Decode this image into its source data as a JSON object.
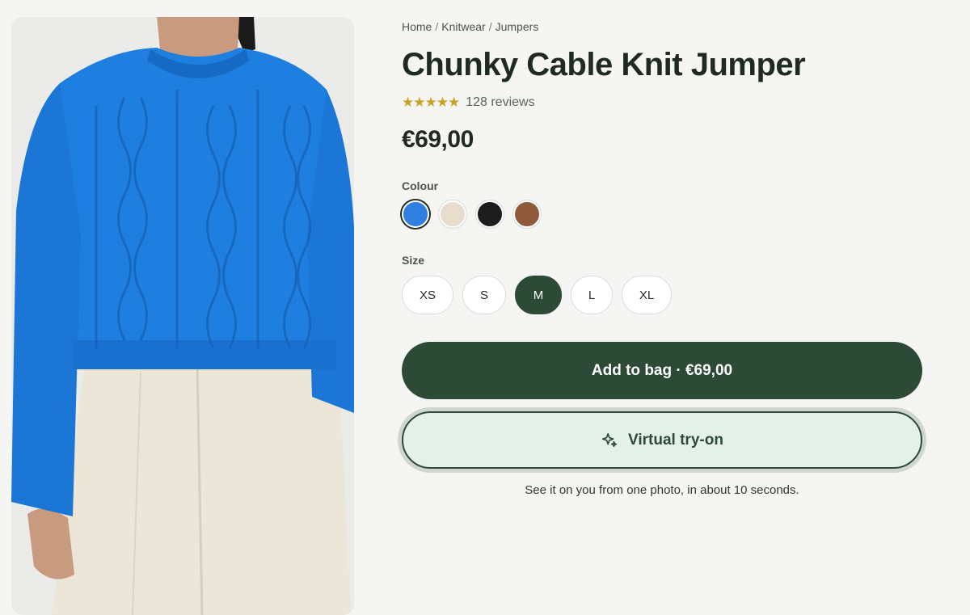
{
  "breadcrumb": [
    "Home",
    "Knitwear",
    "Jumpers"
  ],
  "breadcrumb_separator": "/",
  "product": {
    "title": "Chunky Cable Knit Jumper",
    "stars": "★★★★★",
    "rating_value": 5,
    "rating_max": 5,
    "reviews": "128 reviews",
    "price": "€69,00"
  },
  "colour": {
    "label": "Colour",
    "swatches": [
      {
        "name": "blue",
        "hex": "#2f7fe0",
        "selected": true
      },
      {
        "name": "cream",
        "hex": "#e8dccc",
        "selected": false
      },
      {
        "name": "black",
        "hex": "#1c1c1c",
        "selected": false
      },
      {
        "name": "brown",
        "hex": "#8e5a3a",
        "selected": false
      }
    ]
  },
  "size": {
    "label": "Size",
    "options": [
      "XS",
      "S",
      "M",
      "L",
      "XL"
    ],
    "selected": "M"
  },
  "actions": {
    "add_to_bag": "Add to bag · €69,00",
    "virtual_tryon": "Virtual try-on",
    "tryon_icon": "sparkles-icon",
    "helper": "See it on you from one photo, in about 10 seconds."
  },
  "colors": {
    "accent": "#2d4a37",
    "tryon_bg": "#e4f0ea",
    "star": "#c9a227",
    "sweater": "#1f7fe0",
    "trousers": "#ece6d8"
  }
}
